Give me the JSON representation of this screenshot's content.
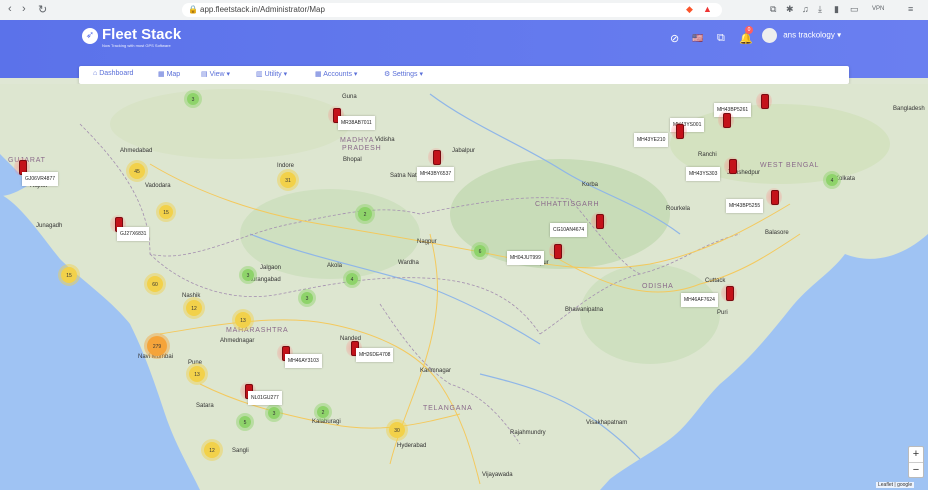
{
  "browser": {
    "url": "app.fleetstack.in/Administrator/Map",
    "vpn_label": "VPN",
    "back_glyph": "‹",
    "forward_glyph": "›",
    "reload_glyph": "↻"
  },
  "header": {
    "app_name": "Fleet Stack",
    "tagline": "Now Tracking with most GPS Software",
    "notification_count": "0",
    "user_name": "ans trackology"
  },
  "menu": {
    "items": [
      {
        "label": "Dashboard",
        "icon": "home-icon"
      },
      {
        "label": "Map",
        "icon": "map-icon"
      },
      {
        "label": "View",
        "icon": "eye-icon"
      },
      {
        "label": "Utility",
        "icon": "tool-icon"
      },
      {
        "label": "Accounts",
        "icon": "accounts-icon"
      },
      {
        "label": "Settings",
        "icon": "gear-icon"
      }
    ]
  },
  "map": {
    "place_labels": [
      "GUJARAT",
      "Ahmedabad",
      "Vadodara",
      "Rajkot",
      "Junagadh",
      "MADHYA",
      "PRADESH",
      "Bhopal",
      "Indore",
      "Vidisha",
      "Guna",
      "Jabalpur",
      "Satna National Park",
      "CHHATTISGARH",
      "Korba",
      "Nagpur",
      "Akola",
      "Wardha",
      "Aurangabad",
      "Nashik",
      "Jalgaon",
      "MAHARASHTRA",
      "Ahmednagar",
      "Navi Mumbai",
      "Pune",
      "Satara",
      "Sangli",
      "Nanded",
      "Karimnagar",
      "TELANGANA",
      "Hyderabad",
      "Kalaburagi",
      "Vijayawada",
      "Rajahmundry",
      "Visakhapatnam",
      "ODISHA",
      "Cuttack",
      "Puri",
      "Balasore",
      "Rourkela",
      "Ranchi",
      "WEST BENGAL",
      "Kolkata",
      "Bangladesh",
      "Raipur",
      "Bhawanipatna",
      "Jamshedpur"
    ],
    "clusters": [
      {
        "count": "3",
        "color": "#8ed36a"
      },
      {
        "count": "45",
        "color": "#f2d14a"
      },
      {
        "count": "15",
        "color": "#f2d14a"
      },
      {
        "count": "15",
        "color": "#f2d14a"
      },
      {
        "count": "60",
        "color": "#f2d14a"
      },
      {
        "count": "3",
        "color": "#8ed36a"
      },
      {
        "count": "31",
        "color": "#f2d14a"
      },
      {
        "count": "2",
        "color": "#8ed36a"
      },
      {
        "count": "6",
        "color": "#8ed36a"
      },
      {
        "count": "4",
        "color": "#8ed36a"
      },
      {
        "count": "3",
        "color": "#8ed36a"
      },
      {
        "count": "4",
        "color": "#8ed36a"
      },
      {
        "count": "12",
        "color": "#f2d14a"
      },
      {
        "count": "13",
        "color": "#f2d14a"
      },
      {
        "count": "279",
        "color": "#f5a43a"
      },
      {
        "count": "13",
        "color": "#f2d14a"
      },
      {
        "count": "5",
        "color": "#8ed36a"
      },
      {
        "count": "3",
        "color": "#8ed36a"
      },
      {
        "count": "30",
        "color": "#f2d14a"
      },
      {
        "count": "12",
        "color": "#f2d14a"
      },
      {
        "count": "2",
        "color": "#8ed36a"
      }
    ],
    "vehicles": [
      "MR38AB7011",
      "MH43BY6537",
      "MH43BP5261",
      "MH43YS001",
      "MH43YE210",
      "MH43YS303",
      "MH43BP5255",
      "CG10AN4674",
      "MH04JUT999",
      "MH46AF7624",
      "MH46AY3103",
      "MH26DE4708",
      "NL01GU277",
      "GJ27X6831",
      "GJ06VR4877"
    ],
    "zoom_in": "+",
    "zoom_out": "−",
    "attribution": "Leaflet | google"
  }
}
